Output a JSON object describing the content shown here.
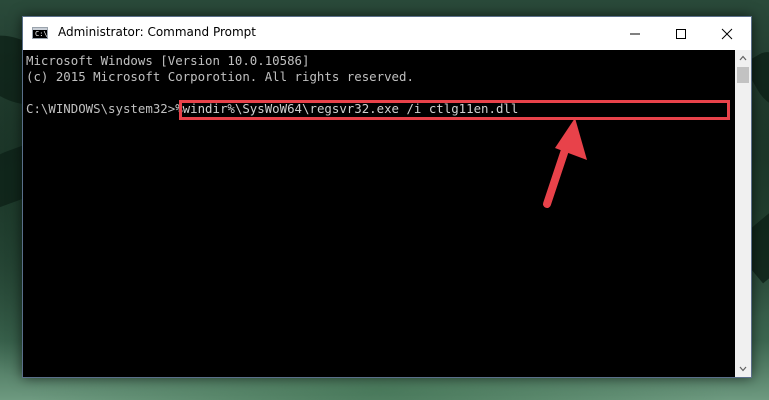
{
  "window": {
    "title": "Administrator: Command Prompt",
    "icon": "cmd-icon",
    "icon_glyph": "C:\\",
    "controls": [
      "minimize-icon",
      "maximize-icon",
      "close-icon"
    ]
  },
  "console": {
    "line1": "Microsoft Windows [Version 10.0.10586]",
    "line2": "(c) 2015 Microsoft Corporotion. All rights reserved.",
    "prompt": "C:\\WINDOWS\\system32>",
    "command": "%windir%\\SysWoW64\\regsvr32.exe /i ctlg11en.dll"
  },
  "annotation": {
    "highlight_color": "#e8424a",
    "arrow_color": "#e8424a"
  },
  "colors": {
    "console_bg": "#000000",
    "console_text": "#c0c0c0",
    "titlebar_bg": "#ffffff"
  }
}
